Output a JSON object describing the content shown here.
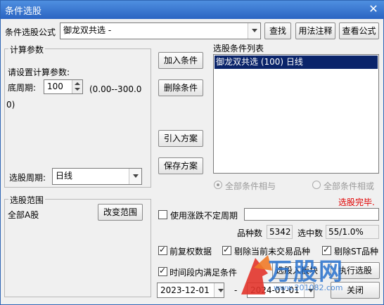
{
  "window": {
    "title": "条件选股"
  },
  "formula": {
    "label": "条件选股公式",
    "value": "御龙双共选  -",
    "find_button": "查找",
    "usage_button": "用法注释",
    "view_button": "查看公式"
  },
  "params": {
    "group_title": "计算参数",
    "prompt": "请设置计算参数:",
    "period_label": "底周期:",
    "period_value": "100",
    "range_text": "(0.00--300.00)",
    "cycle_label": "选股周期:",
    "cycle_value": "日线"
  },
  "actions": {
    "add": "加入条件",
    "delete": "删除条件",
    "import": "引入方案",
    "save": "保存方案"
  },
  "conditions": {
    "title": "选股条件列表",
    "items": [
      "御龙双共选 (100) 日线"
    ],
    "all_and": "全部条件相与",
    "all_or": "全部条件相或"
  },
  "status": {
    "message": "选股完毕."
  },
  "scope": {
    "group_title": "选股范围",
    "value": "全部A股",
    "change_button": "改变范围"
  },
  "options": {
    "use_variable_period": "使用涨跌不定周期",
    "variable_period_value": "",
    "count_label": "品种数",
    "count_value": "5342",
    "selected_label": "选中数",
    "selected_value": "55/1.0%",
    "prev_adjust": "前复权数据",
    "exclude_untraded": "剔除当前未交易品种",
    "exclude_st": "剔除ST品种",
    "time_range": "时间段内满足条件",
    "start_date": "2023-12-01",
    "end_date": "2024-01-01",
    "date_sep": "-"
  },
  "bottom": {
    "to_block": "选股入板块",
    "execute": "执行选股",
    "close": "关闭"
  },
  "watermark": {
    "text": "万股网",
    "url": "www.201082.com"
  },
  "colors": {
    "title_bar": "#2a64c2",
    "selection": "#0a246a",
    "status_red": "#e00000"
  }
}
